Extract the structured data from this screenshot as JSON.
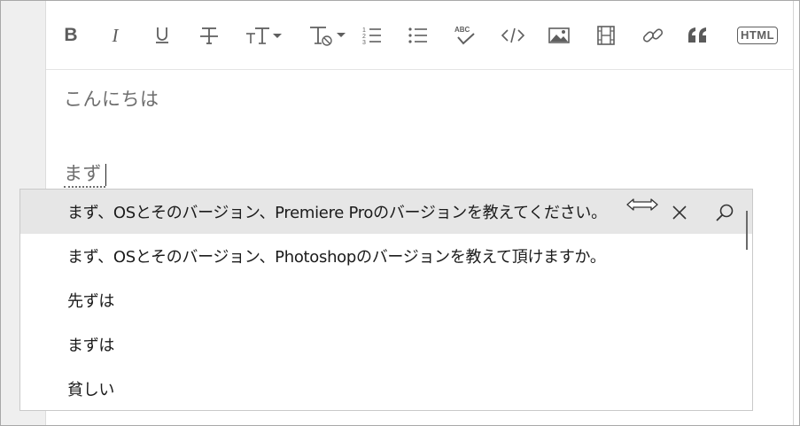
{
  "toolbar": {
    "buttons": [
      {
        "name": "bold",
        "glyph": "B"
      },
      {
        "name": "italic",
        "glyph": "I"
      },
      {
        "name": "underline",
        "glyph": "U"
      },
      {
        "name": "strikethrough",
        "glyph": "T"
      },
      {
        "name": "text-size",
        "glyph": "TT"
      },
      {
        "name": "clear-format",
        "glyph": "Tx"
      },
      {
        "name": "ordered-list",
        "glyph": "1≡"
      },
      {
        "name": "bullet-list",
        "glyph": "•≡"
      },
      {
        "name": "spellcheck",
        "glyph": "ABC"
      },
      {
        "name": "code",
        "glyph": "</>"
      },
      {
        "name": "image",
        "glyph": "img"
      },
      {
        "name": "video",
        "glyph": "film"
      },
      {
        "name": "link",
        "glyph": "link"
      },
      {
        "name": "quote",
        "glyph": "“"
      },
      {
        "name": "html",
        "glyph": "HTML"
      }
    ],
    "html_label": "HTML"
  },
  "editor": {
    "line1": "こんにちは",
    "line2": "まず"
  },
  "suggestions": {
    "selected_index": 0,
    "items": [
      "まず、OSとそのバージョン、Premiere Proのバージョンを教えてください。",
      "まず、OSとそのバージョン、Photoshopのバージョンを教えて頂けますか。",
      "先ずは",
      "まずは",
      "貧しい"
    ],
    "icons": [
      "resize-horizontal-icon",
      "close-icon",
      "search-icon"
    ]
  },
  "colors": {
    "toolbar_icon": "#5f5f5f",
    "selected_row": "#e6e6e6",
    "gutter": "#efefef",
    "border": "#c9c9c9"
  }
}
